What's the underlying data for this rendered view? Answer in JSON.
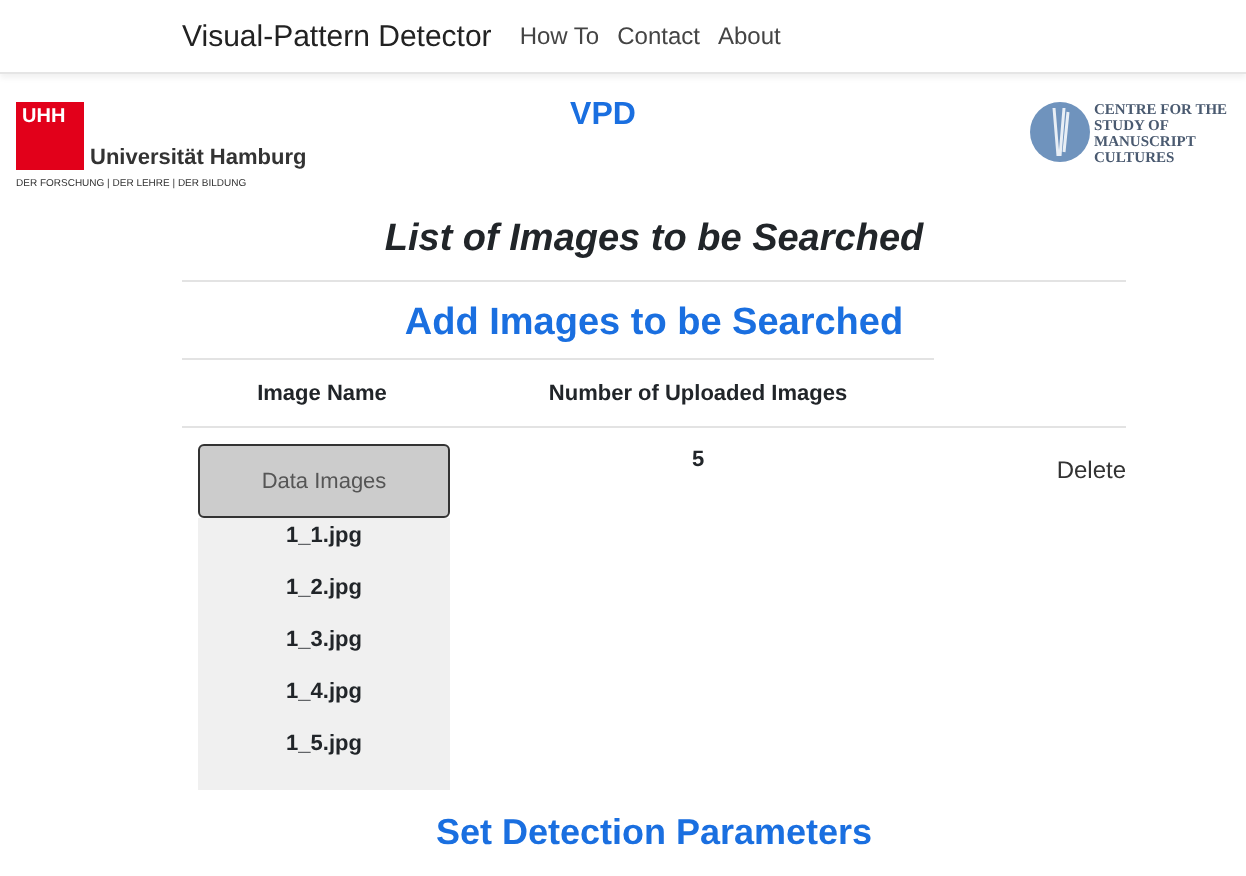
{
  "navbar": {
    "brand": "Visual-Pattern Detector",
    "links": [
      "How To",
      "Contact",
      "About"
    ]
  },
  "header": {
    "left_logo": {
      "mark": "UHH",
      "name": "Universität Hamburg",
      "tagline": "DER FORSCHUNG | DER LEHRE | DER BILDUNG"
    },
    "title": "VPD",
    "right_logo": {
      "lines": [
        "CENTRE FOR THE",
        "STUDY OF",
        "MANUSCRIPT",
        "CULTURES"
      ]
    }
  },
  "page_title": "List of Images to be Searched",
  "add_heading": "Add Images to be Searched",
  "table": {
    "columns": [
      "Image Name",
      "Number of Uploaded Images"
    ],
    "rows": [
      {
        "button": "Data Images",
        "files": [
          "1_1.jpg",
          "1_2.jpg",
          "1_3.jpg",
          "1_4.jpg",
          "1_5.jpg"
        ],
        "count": "5",
        "action": "Delete"
      }
    ]
  },
  "next_heading": "Set Detection Parameters"
}
